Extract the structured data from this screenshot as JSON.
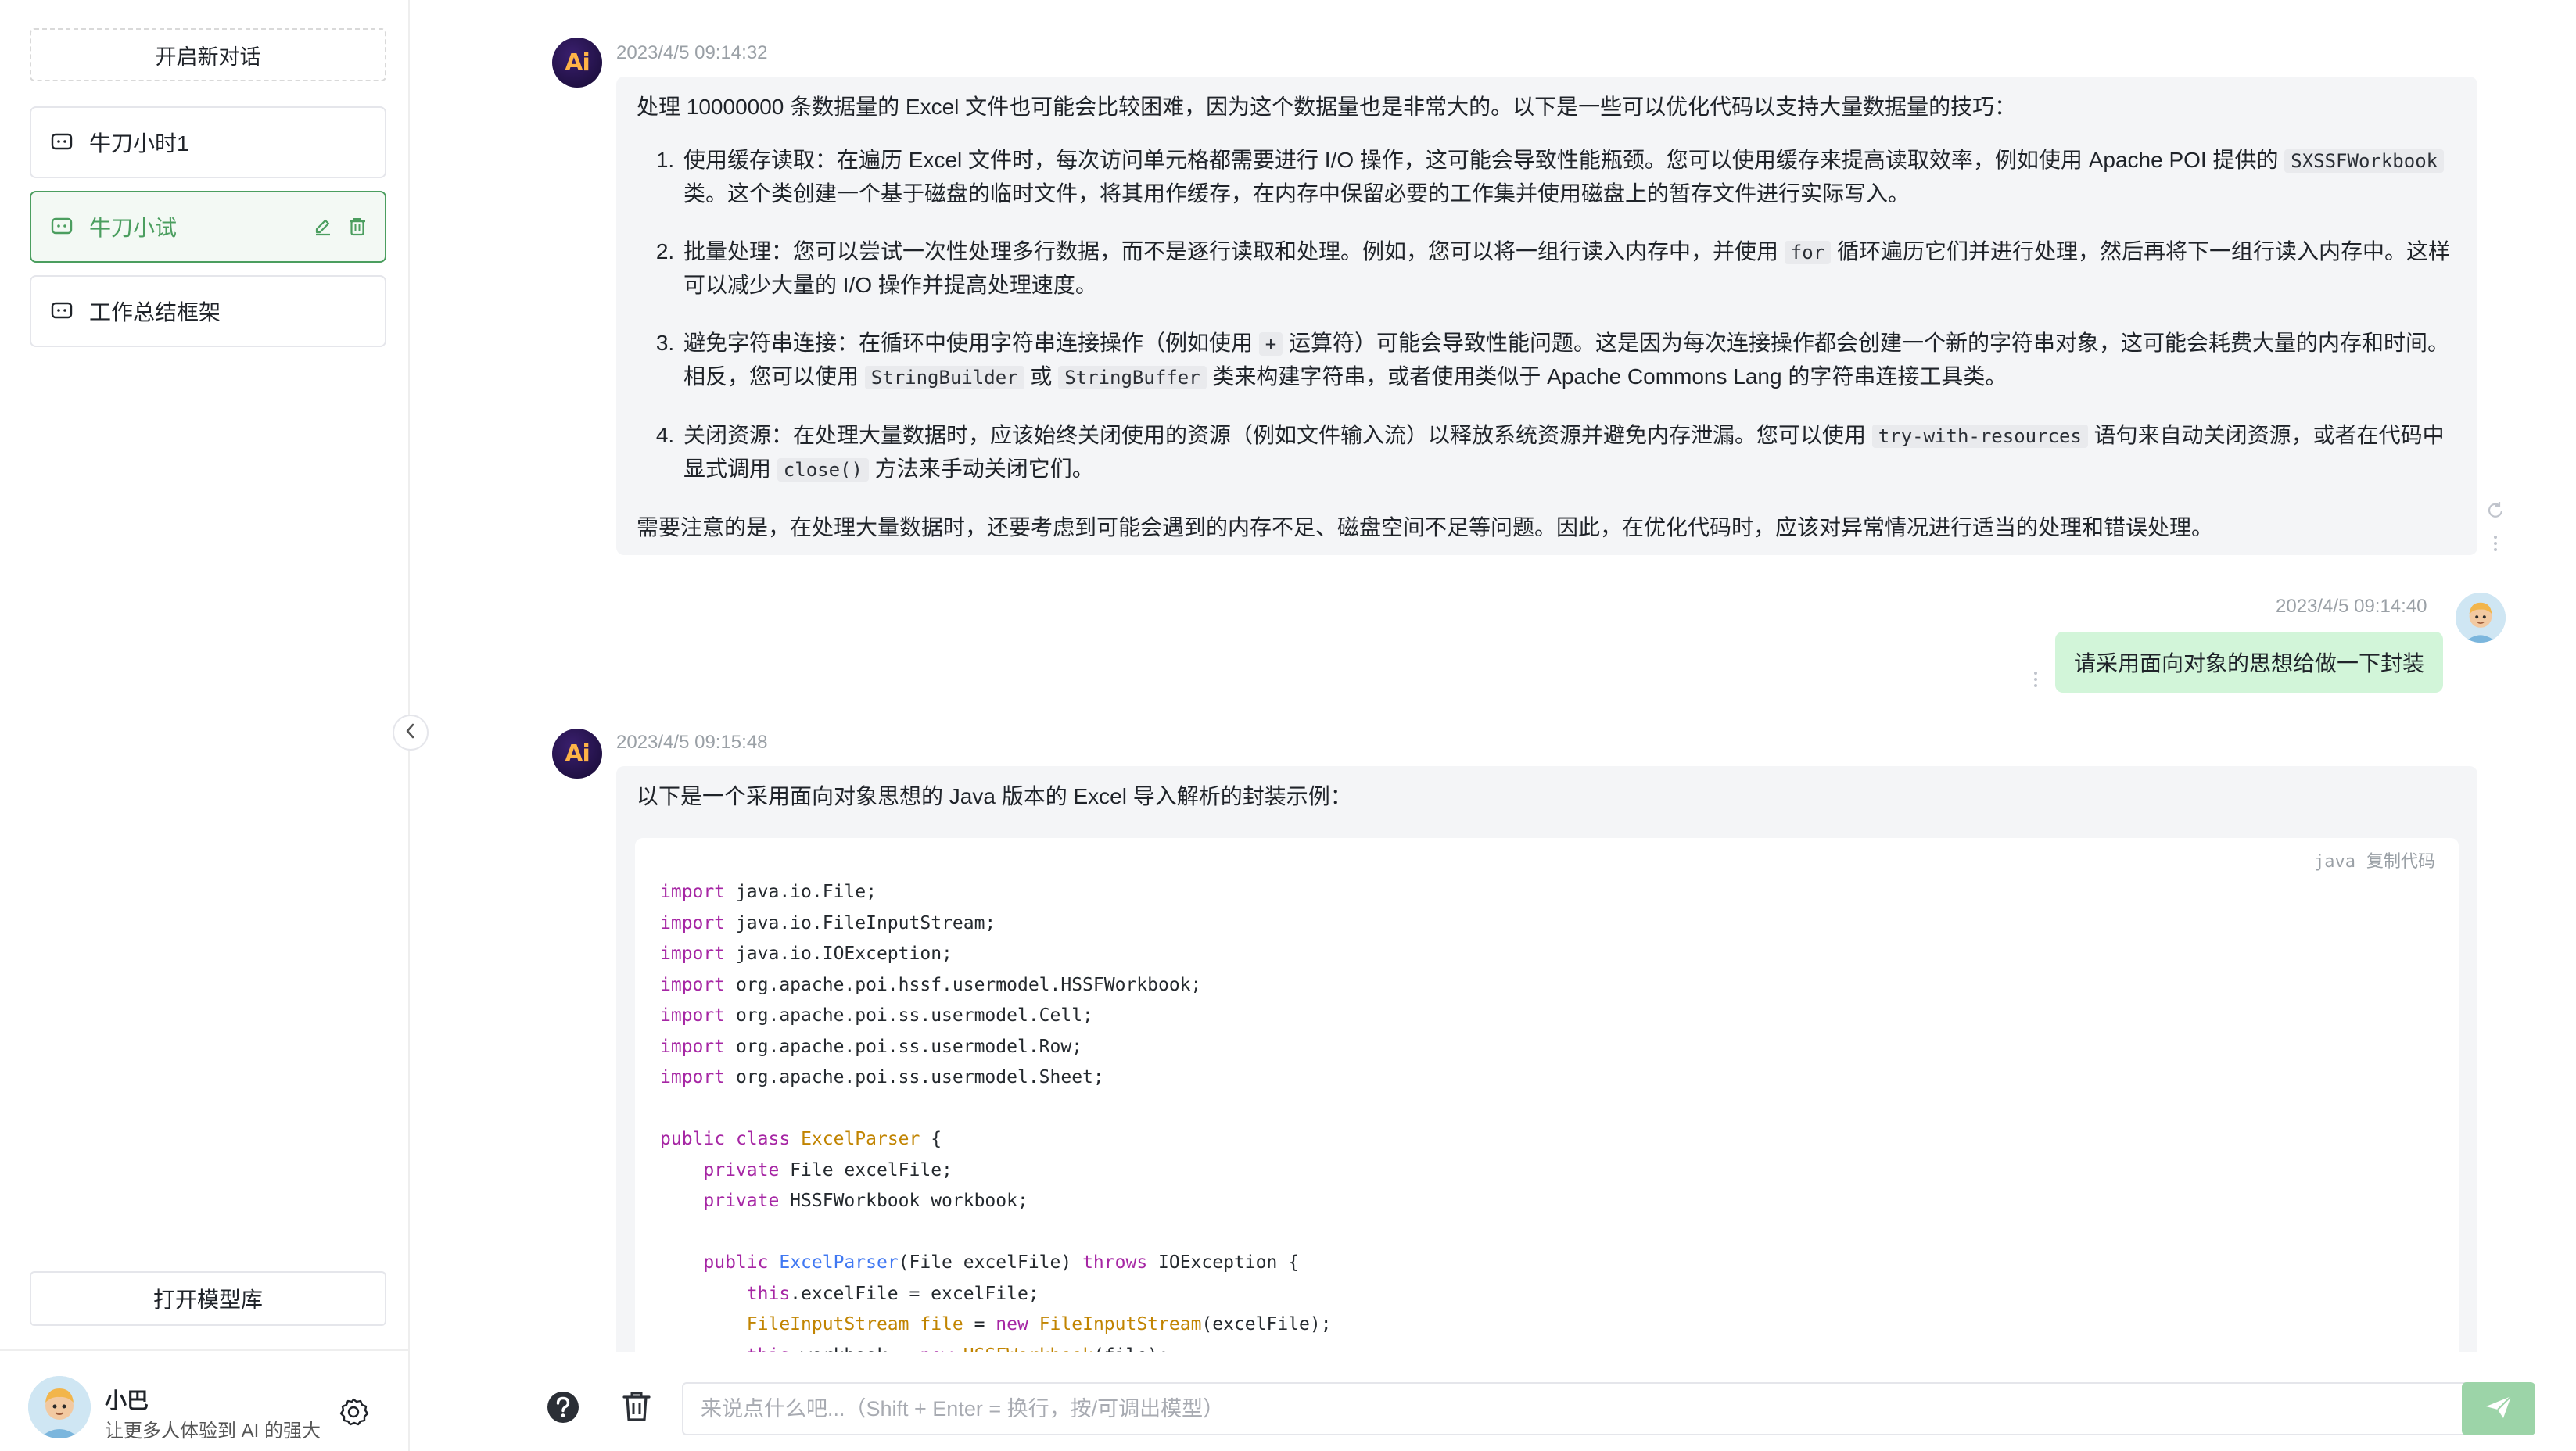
{
  "sidebar": {
    "new_chat_label": "开启新对话",
    "conversations": [
      {
        "label": "牛刀小时1",
        "active": false
      },
      {
        "label": "牛刀小试",
        "active": true
      },
      {
        "label": "工作总结框架",
        "active": false
      }
    ],
    "model_library_label": "打开模型库",
    "user": {
      "name": "小巴",
      "subtitle": "让更多人体验到 AI 的强大"
    }
  },
  "messages": [
    {
      "role": "ai",
      "timestamp": "2023/4/5 09:14:32",
      "intro": "处理 10000000 条数据量的 Excel 文件也可能会比较困难，因为这个数据量也是非常大的。以下是一些可以优化代码以支持大量数据量的技巧：",
      "items": [
        {
          "a": "使用缓存读取：在遍历 Excel 文件时，每次访问单元格都需要进行 I/O 操作，这可能会导致性能瓶颈。您可以使用缓存来提高读取效率，例如使用 Apache POI 提供的",
          "code1": "SXSSFWorkbook",
          "b": "类。这个类创建一个基于磁盘的临时文件，将其用作缓存，在内存中保留必要的工作集并使用磁盘上的暂存文件进行实际写入。"
        },
        {
          "a": "批量处理：您可以尝试一次性处理多行数据，而不是逐行读取和处理。例如，您可以将一组行读入内存中，并使用",
          "code1": "for",
          "b": "循环遍历它们并进行处理，然后再将下一组行读入内存中。这样可以减少大量的 I/O 操作并提高处理速度。"
        },
        {
          "a": "避免字符串连接：在循环中使用字符串连接操作（例如使用",
          "code1": "+",
          "b": "运算符）可能会导致性能问题。这是因为每次连接操作都会创建一个新的字符串对象，这可能会耗费大量的内存和时间。相反，您可以使用",
          "code2": "StringBuilder",
          "c": "或",
          "code3": "StringBuffer",
          "d": "类来构建字符串，或者使用类似于 Apache Commons Lang 的字符串连接工具类。"
        },
        {
          "a": "关闭资源：在处理大量数据时，应该始终关闭使用的资源（例如文件输入流）以释放系统资源并避免内存泄漏。您可以使用",
          "code1": "try-with-resources",
          "b": "语句来自动关闭资源，或者在代码中显式调用",
          "code2": "close()",
          "c": "方法来手动关闭它们。"
        }
      ],
      "outro": "需要注意的是，在处理大量数据时，还要考虑到可能会遇到的内存不足、磁盘空间不足等问题。因此，在优化代码时，应该对异常情况进行适当的处理和错误处理。"
    },
    {
      "role": "user",
      "timestamp": "2023/4/5 09:14:40",
      "text": "请采用面向对象的思想给做一下封装"
    },
    {
      "role": "ai",
      "timestamp": "2023/4/5 09:15:48",
      "intro": "以下是一个采用面向对象思想的 Java 版本的 Excel 导入解析的封装示例：",
      "code_language": "java",
      "copy_label": "复制代码",
      "code": [
        "import java.io.File;",
        "import java.io.FileInputStream;",
        "import java.io.IOException;",
        "import org.apache.poi.hssf.usermodel.HSSFWorkbook;",
        "import org.apache.poi.ss.usermodel.Cell;",
        "import org.apache.poi.ss.usermodel.Row;",
        "import org.apache.poi.ss.usermodel.Sheet;",
        "",
        "public class ExcelParser {",
        "    private File excelFile;",
        "    private HSSFWorkbook workbook;",
        "",
        "    public ExcelParser(File excelFile) throws IOException {",
        "        this.excelFile = excelFile;",
        "        FileInputStream file = new FileInputStream(excelFile);",
        "        this.workbook = new HSSFWorkbook(file);"
      ]
    }
  ],
  "input": {
    "placeholder": "来说点什么吧...（Shift + Enter = 换行，按/可调出模型）",
    "value": ""
  },
  "colors": {
    "accent": "#4b9e5f",
    "user_bubble": "#d2f5d9",
    "ai_bubble": "#f4f5f7",
    "send_button": "#9cd4a8"
  },
  "icons": [
    "chat-bubble-icon",
    "edit-icon",
    "delete-icon",
    "settings-icon",
    "chevron-left-icon",
    "help-icon",
    "trash-icon",
    "send-icon",
    "refresh-icon",
    "more-icon"
  ]
}
